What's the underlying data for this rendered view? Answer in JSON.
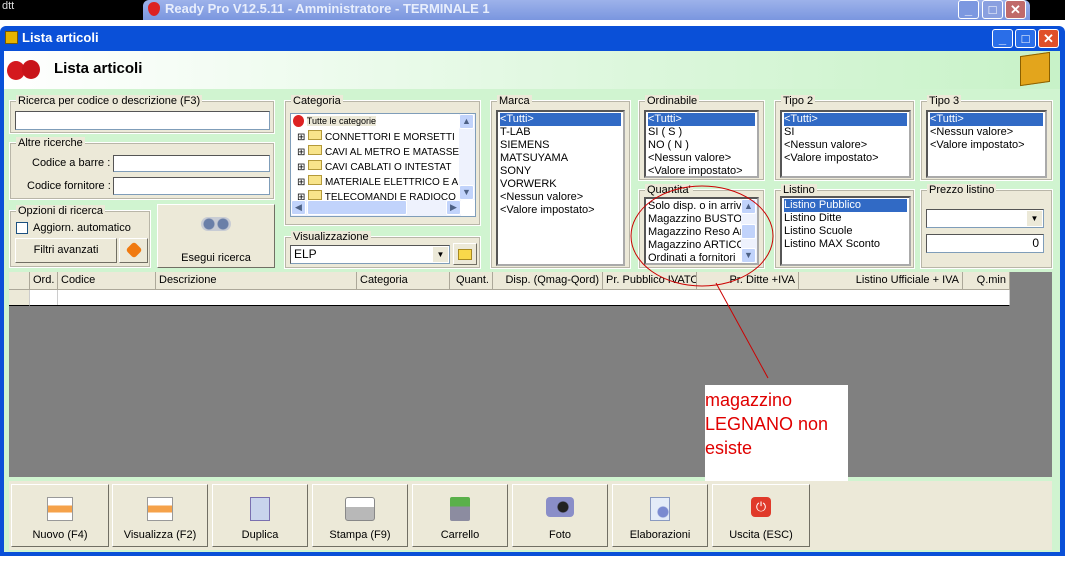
{
  "os": {
    "corner_text": "dtt",
    "app_title": "Ready Pro V12.5.11 - Amministratore - TERMINALE 1"
  },
  "window": {
    "title": "Lista articoli",
    "header_title": "Lista articoli"
  },
  "search": {
    "group_label": "Ricerca per codice o descrizione (F3)",
    "value": "",
    "other_label": "Altre ricerche",
    "barcode_label": "Codice a barre :",
    "supplier_label": "Codice fornitore :",
    "options_label": "Opzioni di ricerca",
    "auto_update_label": "Aggiorn. automatico",
    "auto_update_checked": false,
    "advanced_filters": "Filtri avanzati",
    "run_search": "Esegui ricerca"
  },
  "categoria": {
    "label": "Categoria",
    "root": "Tutte le categorie",
    "items": [
      "CONNETTORI E MORSETTI",
      "CAVI AL METRO E MATASSE",
      "CAVI CABLATI O INTESTAT",
      "MATERIALE ELETTRICO E A",
      "TELECOMANDI E RADIOCO"
    ]
  },
  "visualizzazione": {
    "label": "Visualizzazione",
    "value": "ELP"
  },
  "marca": {
    "label": "Marca",
    "items": [
      "<Tutti>",
      "T-LAB",
      "SIEMENS",
      "MATSUYAMA",
      "SONY",
      "VORWERK",
      "<Nessun valore>",
      "<Valore impostato>"
    ],
    "selected": 0
  },
  "ordinabile": {
    "label": "Ordinabile",
    "items": [
      "<Tutti>",
      "SI ( S )",
      "NO ( N )",
      "<Nessun valore>",
      "<Valore impostato>"
    ],
    "selected": 0
  },
  "quantita": {
    "label": "Quantita'",
    "items": [
      "Solo disp. o in arrivo",
      "Magazzino BUSTO A",
      "Magazzino Reso Arti",
      "Magazzino ARTICOL",
      "Ordinati a fornitori"
    ]
  },
  "tipo2": {
    "label": "Tipo 2",
    "items": [
      "<Tutti>",
      "SI",
      "<Nessun valore>",
      "<Valore impostato>"
    ],
    "selected": 0
  },
  "listino": {
    "label": "Listino",
    "items": [
      "Listino Pubblico",
      "Listino Ditte",
      "Listino Scuole",
      "Listino MAX Sconto"
    ],
    "selected": 0
  },
  "tipo3": {
    "label": "Tipo 3",
    "items": [
      "<Tutti>",
      "<Nessun valore>",
      "<Valore impostato>"
    ],
    "selected": 0
  },
  "prezzo": {
    "label": "Prezzo listino",
    "select_value": "",
    "value": "0"
  },
  "table": {
    "columns": [
      "Ord.",
      "Codice",
      "Descrizione",
      "Categoria",
      "Quant.",
      "Disp. (Qmag-Qord)",
      "Pr. Pubblico IVATO",
      "Pr. Ditte +IVA",
      "Listino Ufficiale + IVA",
      "Q.min"
    ]
  },
  "toolbar": [
    "Nuovo (F4)",
    "Visualizza (F2)",
    "Duplica",
    "Stampa (F9)",
    "Carrello",
    "Foto",
    "Elaborazioni",
    "Uscita (ESC)"
  ],
  "annotation": {
    "text": "magazzino LEGNANO non esiste",
    "color": "#e00000"
  }
}
